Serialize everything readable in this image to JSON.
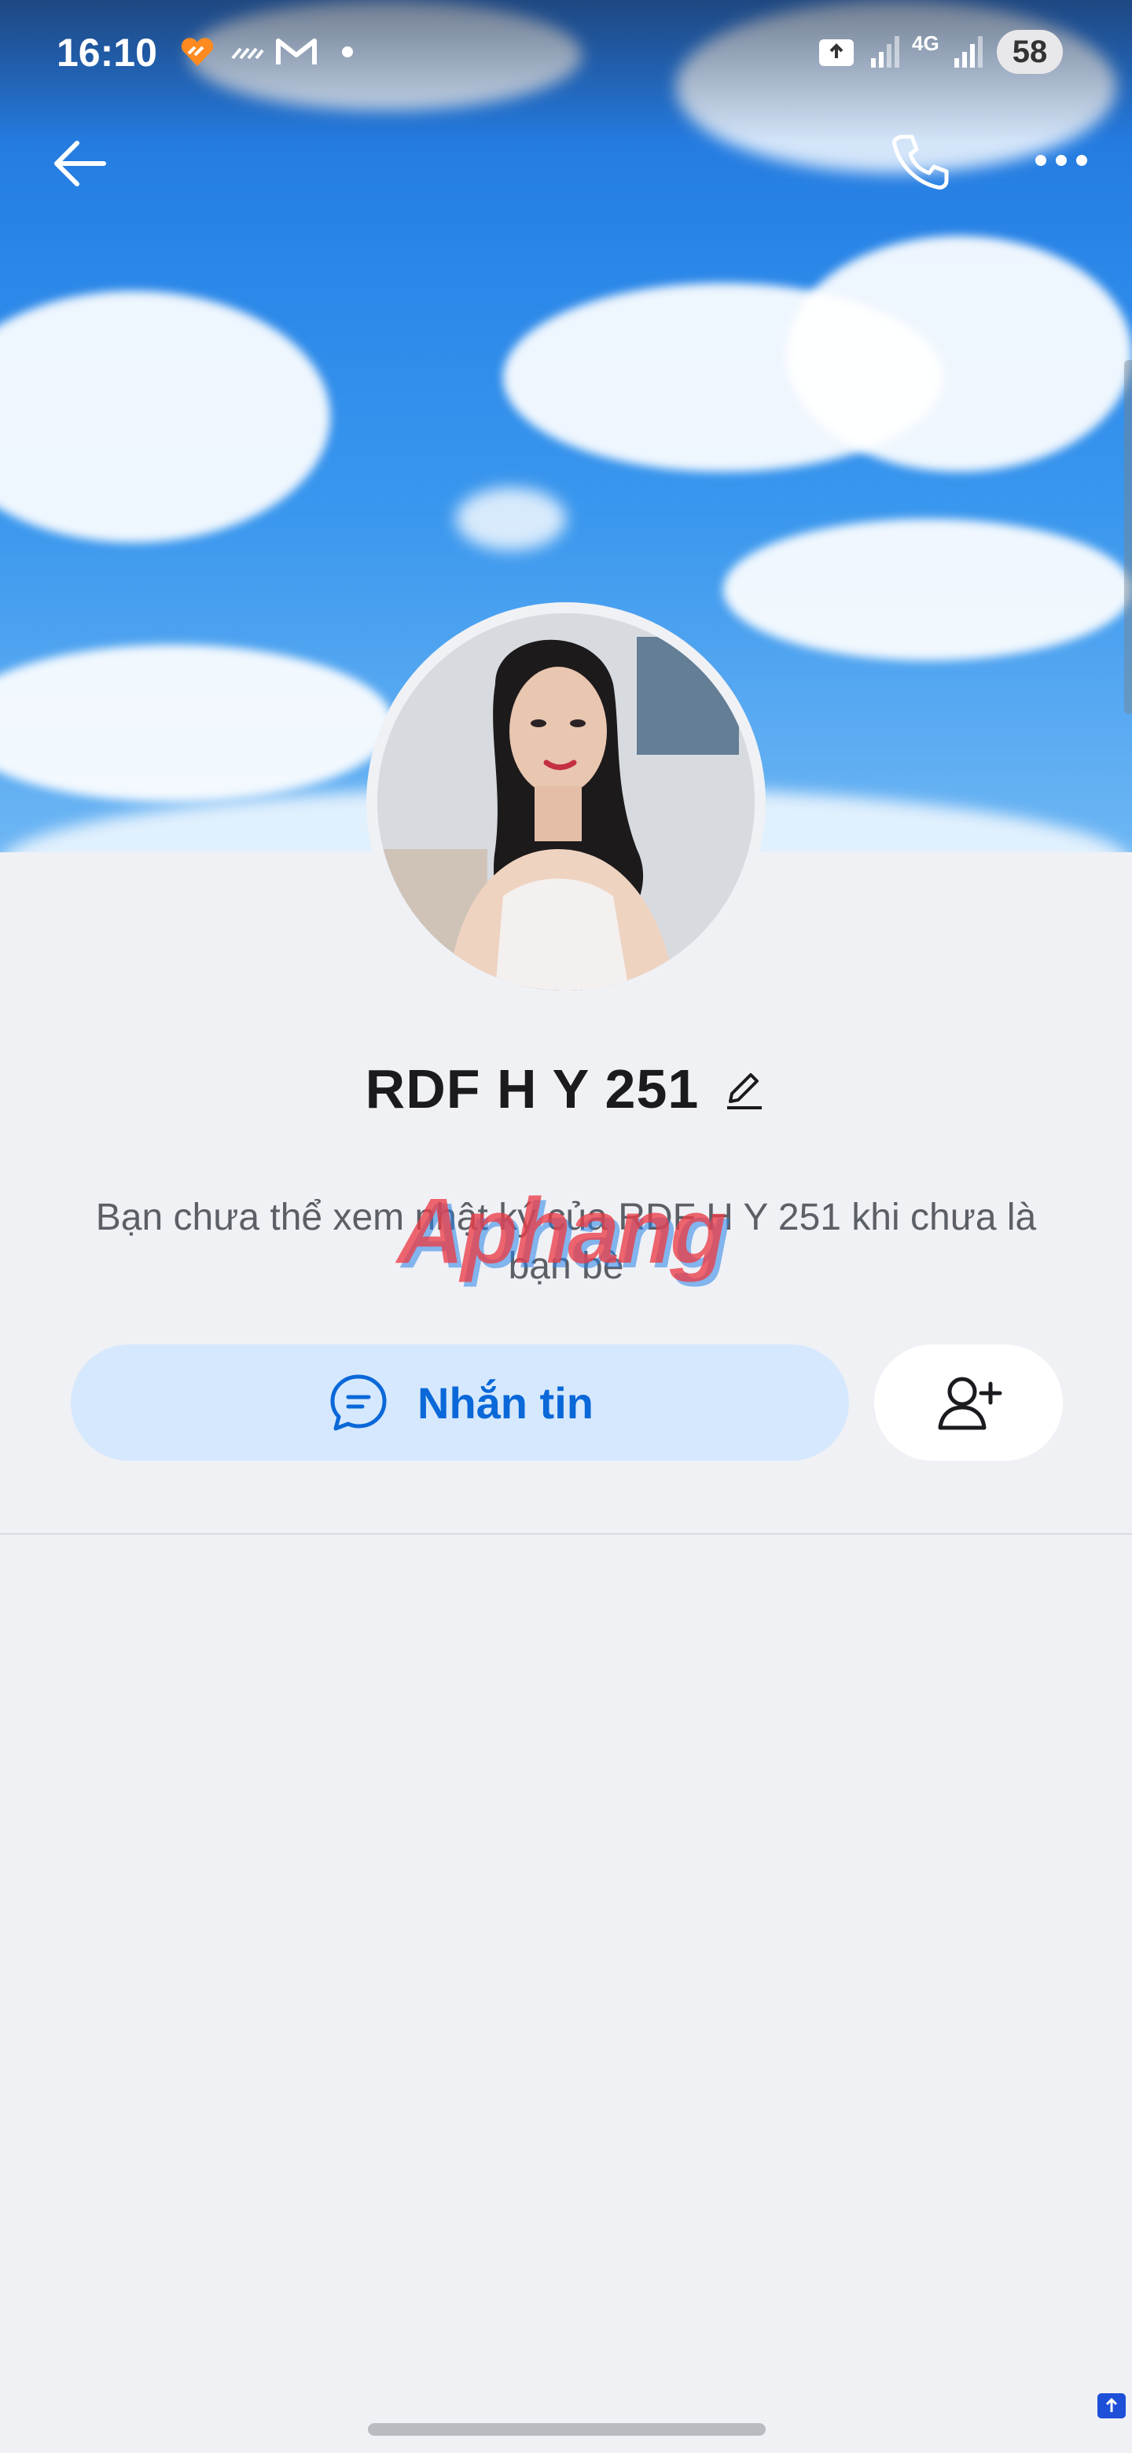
{
  "status_bar": {
    "time": "16:10",
    "network": "4G",
    "battery": "58",
    "icons": [
      "heart-badge-icon",
      "data-saver-icon",
      "gmail-icon",
      "dot-icon",
      "screenshot-icon",
      "signal-icon",
      "signal-icon"
    ]
  },
  "header": {
    "back_icon": "arrow-left-icon",
    "call_icon": "phone-icon",
    "more_icon": "more-horizontal-icon"
  },
  "profile": {
    "name": "RDF H Y 251",
    "privacy_note": "Bạn chưa thể xem nhật ký của RDF H Y 251 khi chưa là bạn bè"
  },
  "watermark": "Aphang",
  "actions": {
    "message_label": "Nhắn tin",
    "message_icon": "chat-bubble-icon",
    "add_friend_icon": "add-friend-icon"
  },
  "colors": {
    "accent": "#0a68d8",
    "message_button_bg": "#d6e8fd",
    "page_bg": "#f0f1f5"
  }
}
